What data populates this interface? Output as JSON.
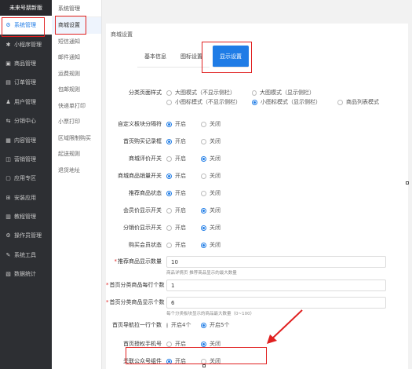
{
  "brand": "未来号朋新版",
  "sidebar": {
    "items": [
      {
        "label": "系统管理",
        "icon": "gear-icon",
        "glyph": "⚙",
        "active": true
      },
      {
        "label": "小程序管理",
        "icon": "miniapp-icon",
        "glyph": "✱",
        "active": false
      },
      {
        "label": "商品管理",
        "icon": "goods-icon",
        "glyph": "▣",
        "active": false
      },
      {
        "label": "订单管理",
        "icon": "order-icon",
        "glyph": "▤",
        "active": false
      },
      {
        "label": "用户管理",
        "icon": "user-icon",
        "glyph": "♟",
        "active": false
      },
      {
        "label": "分销中心",
        "icon": "distribution-icon",
        "glyph": "⇆",
        "active": false
      },
      {
        "label": "内容管理",
        "icon": "content-icon",
        "glyph": "▦",
        "active": false
      },
      {
        "label": "营销管理",
        "icon": "marketing-icon",
        "glyph": "◫",
        "active": false
      },
      {
        "label": "应用专区",
        "icon": "apps-icon",
        "glyph": "▢",
        "active": false
      },
      {
        "label": "安装应用",
        "icon": "install-icon",
        "glyph": "⊞",
        "active": false
      },
      {
        "label": "教程管理",
        "icon": "tutorial-icon",
        "glyph": "▥",
        "active": false
      },
      {
        "label": "操作员管理",
        "icon": "operator-icon",
        "glyph": "⚙",
        "active": false
      },
      {
        "label": "系统工具",
        "icon": "tools-icon",
        "glyph": "✎",
        "active": false
      },
      {
        "label": "数据统计",
        "icon": "stats-icon",
        "glyph": "▧",
        "active": false
      }
    ]
  },
  "submenu": {
    "title": "系统管理",
    "items": [
      {
        "label": "商城设置",
        "active": true
      },
      {
        "label": "短信通知",
        "active": false
      },
      {
        "label": "邮件通知",
        "active": false
      },
      {
        "label": "运费规则",
        "active": false
      },
      {
        "label": "包邮规则",
        "active": false
      },
      {
        "label": "快递单打印",
        "active": false
      },
      {
        "label": "小票打印",
        "active": false
      },
      {
        "label": "区域限制购买",
        "active": false
      },
      {
        "label": "起送规则",
        "active": false
      },
      {
        "label": "退货地址",
        "active": false
      }
    ]
  },
  "main": {
    "title": "商城设置",
    "tabs": [
      {
        "label": "基本信息",
        "active": false
      },
      {
        "label": "图标设置",
        "active": false
      },
      {
        "label": "显示设置",
        "active": true
      }
    ]
  },
  "form": {
    "category_style": {
      "label": "分类页面样式",
      "options": [
        {
          "label": "大图模式（不显示侧栏）",
          "checked": false
        },
        {
          "label": "大图模式（显示侧栏）",
          "checked": false
        },
        {
          "label": "小图标模式（不显示侧栏）",
          "checked": false
        },
        {
          "label": "小图标模式（显示侧栏）",
          "checked": true
        },
        {
          "label": "商品列表模式",
          "checked": false
        }
      ]
    },
    "toggles": [
      {
        "key": "custom_separator",
        "label": "自定义板块分隔符",
        "on": "开启",
        "off": "关闭",
        "value": "on"
      },
      {
        "key": "home_buy_record",
        "label": "首页购买记录框",
        "on": "开启",
        "off": "关闭",
        "value": "on"
      },
      {
        "key": "mall_review",
        "label": "商城评价开关",
        "on": "开启",
        "off": "关闭",
        "value": "off"
      },
      {
        "key": "mall_sales",
        "label": "商城商品销量开关",
        "on": "开启",
        "off": "关闭",
        "value": "on"
      },
      {
        "key": "recommend_status",
        "label": "推荐商品状态",
        "on": "开启",
        "off": "关闭",
        "value": "on"
      },
      {
        "key": "member_price",
        "label": "会员价显示开关",
        "on": "开启",
        "off": "关闭",
        "value": "off"
      },
      {
        "key": "distribution_price",
        "label": "分销价显示开关",
        "on": "开启",
        "off": "关闭",
        "value": "off"
      },
      {
        "key": "buy_member_status",
        "label": "购买会员状态",
        "on": "开启",
        "off": "关闭",
        "value": "off"
      }
    ],
    "recommend_count": {
      "label": "推荐商品显示数量",
      "value": "10",
      "hint": "商品详情页 推荐商品显示的最大数量"
    },
    "home_row_count": {
      "label": "首页分类商品每行个数",
      "value": "1"
    },
    "home_display_count": {
      "label": "首页分类商品显示个数",
      "value": "6",
      "hint": "每个分类板块显示的商品最大数量（0~100）"
    },
    "nav_per_row": {
      "label": "首页导航拉一行个数",
      "opt_a": "开启4个",
      "opt_b": "开启5个",
      "value": "b"
    },
    "bind_phone": {
      "label": "首页授权手机号",
      "on": "开启",
      "off": "关闭",
      "value": "off"
    },
    "follow_official": {
      "label": "关联公众号组件",
      "on": "开启",
      "off": "关闭",
      "value": "on"
    }
  },
  "colors": {
    "accent": "#1f7ce6",
    "highlight": "#e02020",
    "sidebar": "#2d2f33"
  }
}
